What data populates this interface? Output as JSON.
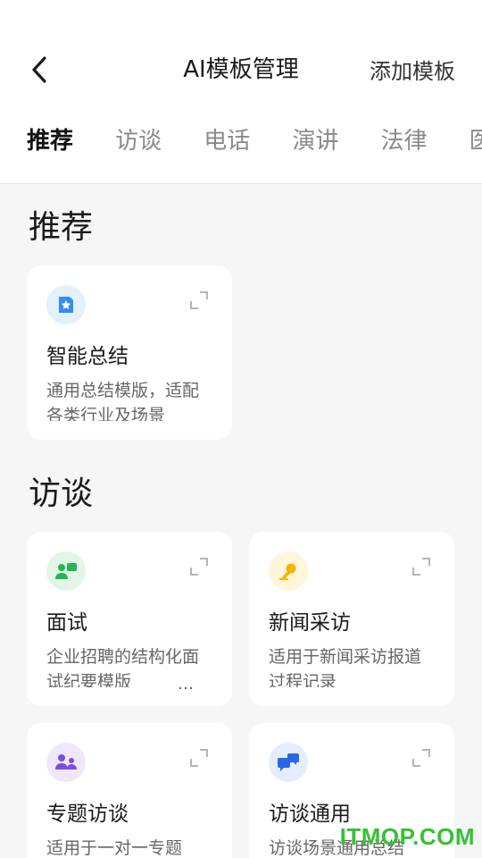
{
  "header": {
    "title": "AI模板管理",
    "add_label": "添加模板"
  },
  "tabs": [
    {
      "label": "推荐",
      "active": true
    },
    {
      "label": "访谈",
      "active": false
    },
    {
      "label": "电话",
      "active": false
    },
    {
      "label": "演讲",
      "active": false
    },
    {
      "label": "法律",
      "active": false
    },
    {
      "label": "医",
      "active": false
    }
  ],
  "sections": {
    "recommend": {
      "title": "推荐",
      "cards": [
        {
          "name": "智能总结",
          "desc": "通用总结模版，适配各类行业及场景",
          "icon": "star-document-icon",
          "icon_color": "#2f8df5",
          "icon_bg": "#e3f1fb"
        }
      ]
    },
    "interview": {
      "title": "访谈",
      "cards": [
        {
          "name": "面试",
          "desc": "企业招聘的结构化面试纪要模版",
          "more": "…",
          "icon": "interview-people-icon",
          "icon_color": "#22b455",
          "icon_bg": "#e2f6e8"
        },
        {
          "name": "新闻采访",
          "desc": "适用于新闻采访报道过程记录",
          "icon": "microphone-icon",
          "icon_color": "#f5b400",
          "icon_bg": "#fff5da"
        },
        {
          "name": "专题访谈",
          "desc": "适用于一对一专题",
          "icon": "group-chat-icon",
          "icon_color": "#7a4ee0",
          "icon_bg": "#efe8fc"
        },
        {
          "name": "访谈通用",
          "desc": "访谈场景通用总结",
          "icon": "chat-bubbles-icon",
          "icon_color": "#2a66e8",
          "icon_bg": "#e5edfc"
        }
      ]
    }
  },
  "watermark": "ITMOP.COM"
}
